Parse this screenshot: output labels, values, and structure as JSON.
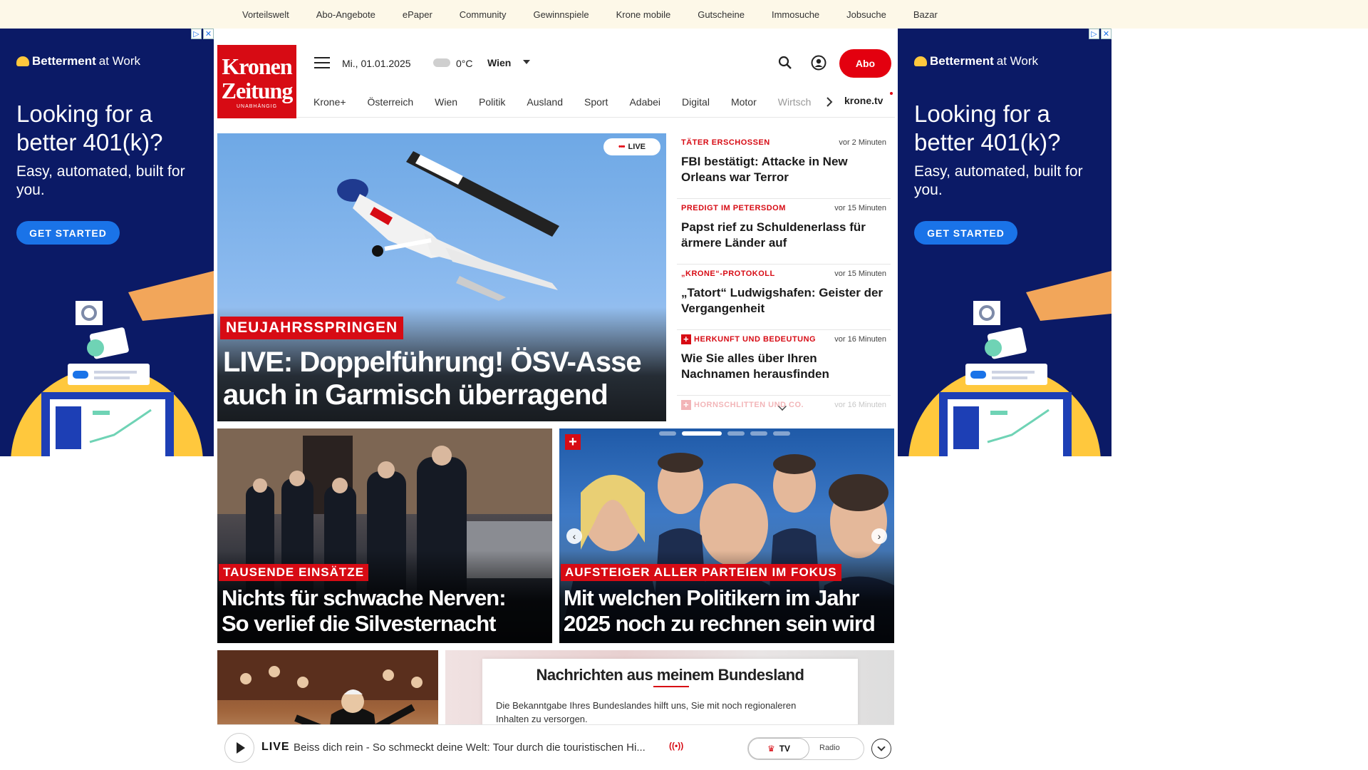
{
  "topbar": {
    "links": [
      "Vorteilswelt",
      "Abo-Angebote",
      "ePaper",
      "Community",
      "Gewinnspiele",
      "Krone mobile",
      "Gutscheine",
      "Immosuche",
      "Jobsuche",
      "Bazar"
    ]
  },
  "ad": {
    "brand_bold": "Betterment",
    "brand_thin": "at Work",
    "headline": "Looking for a better 401(k)?",
    "sub": "Easy, automated, built for you.",
    "cta": "GET STARTED",
    "close_icon": "close-icon",
    "info_icon": "adchoices-icon"
  },
  "header": {
    "logo_line1": "Kronen",
    "logo_line2": "Zeitung",
    "logo_tag": "UNABHÄNGIG",
    "date": "Mi., 01.01.2025",
    "temperature": "0°C",
    "city": "Wien",
    "abo_label": "Abo"
  },
  "nav": {
    "items": [
      "Krone+",
      "Österreich",
      "Wien",
      "Politik",
      "Ausland",
      "Sport",
      "Adabei",
      "Digital",
      "Motor"
    ],
    "faded_item": "Wirtsch",
    "krone_tv": "krone.tv"
  },
  "hero": {
    "live_badge": "LIVE",
    "kicker": "NEUJAHRSSPRINGEN",
    "title": "LIVE: Doppelführung! ÖSV-Asse auch in Garmisch überragend"
  },
  "news": [
    {
      "category": "TÄTER ERSCHOSSEN",
      "time": "vor 2 Minuten",
      "title": "FBI bestätigt: Attacke in New Orleans war Terror",
      "plus": false
    },
    {
      "category": "PREDIGT IM PETERSDOM",
      "time": "vor 15 Minuten",
      "title": "Papst rief zu Schuldenerlass für ärmere Länder auf",
      "plus": false
    },
    {
      "category": "„KRONE“-PROTOKOLL",
      "time": "vor 15 Minuten",
      "title": "„Tatort“ Ludwigshafen: Geister der Vergangenheit",
      "plus": false
    },
    {
      "category": "HERKUNFT UND BEDEUTUNG",
      "time": "vor 16 Minuten",
      "title": "Wie Sie alles über Ihren Nachnamen herausfinden",
      "plus": true
    },
    {
      "category": "HORNSCHLITTEN UND CO.",
      "time": "vor 16 Minuten",
      "title": "",
      "plus": true
    }
  ],
  "cards": [
    {
      "kicker": "TAUSENDE EINSÄTZE",
      "title_line1": "Nichts für schwache Nerven:",
      "title_line2": "So verlief die Silvesternacht"
    },
    {
      "kicker": "AUFSTEIGER ALLER PARTEIEN IM FOKUS",
      "title_line1": "Mit welchen Politikern im Jahr",
      "title_line2": "2025 noch zu rechnen sein wird"
    }
  ],
  "bundesland": {
    "heading": "Nachrichten aus meinem Bundesland",
    "text": "Die Bekanntgabe Ihres Bundeslandes hilft uns, Sie mit noch regionaleren Inhalten zu versorgen."
  },
  "player": {
    "live_label": "LIVE",
    "title": "Beiss dich rein - So schmeckt deine Welt: Tour durch die touristischen Hi...",
    "tv_label": "TV",
    "radio_label": "Radio"
  },
  "colors": {
    "brand_red": "#d70b14",
    "ad_navy": "#0b1a66",
    "cta_blue": "#1a73e8",
    "topbar_bg": "#fdf8e8"
  }
}
